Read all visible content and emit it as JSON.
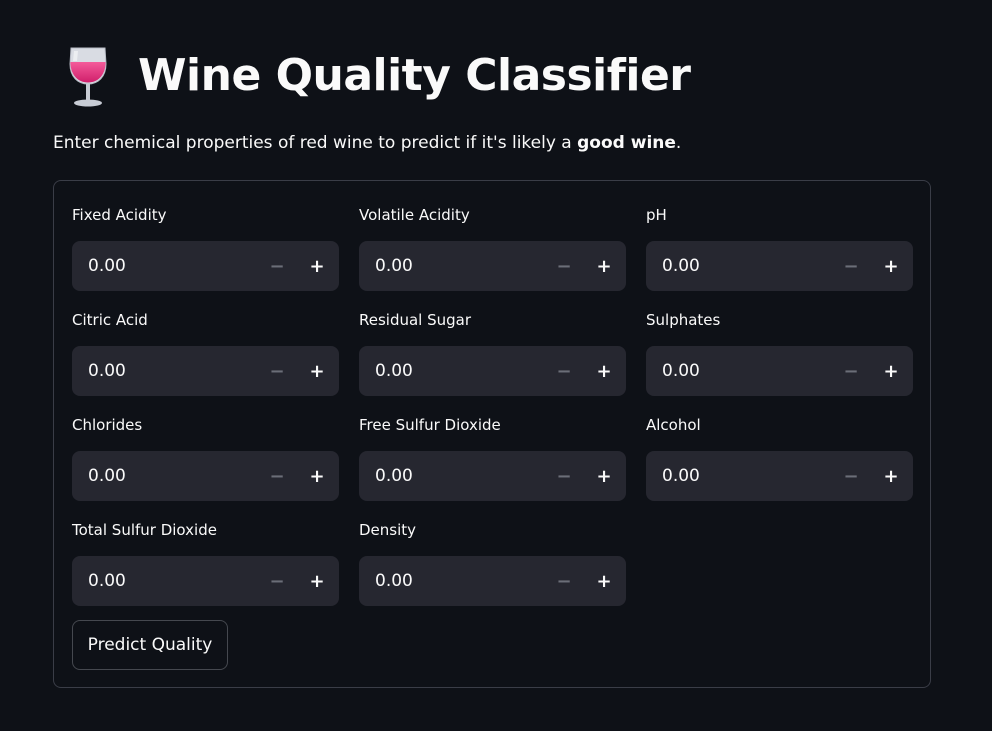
{
  "header": {
    "title": "Wine Quality Classifier",
    "icon": "wine-glass-icon",
    "subtitle_prefix": "Enter chemical properties of red wine to predict if it's likely a ",
    "subtitle_bold": "good wine",
    "subtitle_suffix": "."
  },
  "fields": {
    "fixed_acidity": {
      "label": "Fixed Acidity",
      "value": "0.00"
    },
    "volatile_acidity": {
      "label": "Volatile Acidity",
      "value": "0.00"
    },
    "ph": {
      "label": "pH",
      "value": "0.00"
    },
    "citric_acid": {
      "label": "Citric Acid",
      "value": "0.00"
    },
    "residual_sugar": {
      "label": "Residual Sugar",
      "value": "0.00"
    },
    "sulphates": {
      "label": "Sulphates",
      "value": "0.00"
    },
    "chlorides": {
      "label": "Chlorides",
      "value": "0.00"
    },
    "free_sulfur_dioxide": {
      "label": "Free Sulfur Dioxide",
      "value": "0.00"
    },
    "alcohol": {
      "label": "Alcohol",
      "value": "0.00"
    },
    "total_sulfur_dioxide": {
      "label": "Total Sulfur Dioxide",
      "value": "0.00"
    },
    "density": {
      "label": "Density",
      "value": "0.00"
    }
  },
  "stepper": {
    "minus": "−",
    "plus": "+"
  },
  "predict_button": {
    "label": "Predict Quality"
  },
  "colors": {
    "background": "#0e1117",
    "input_background": "#262730",
    "text": "#fafafa",
    "border": "#3a3d47",
    "wine": "#e8337a"
  }
}
